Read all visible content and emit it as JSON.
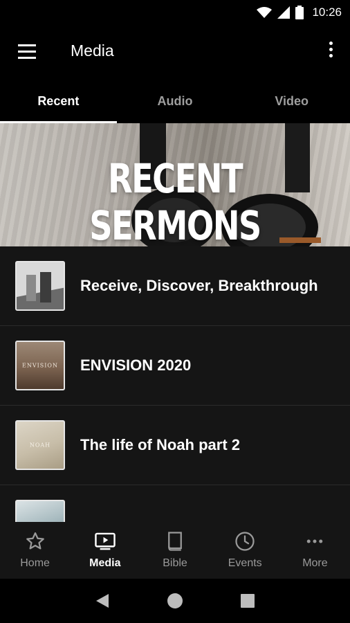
{
  "status_bar": {
    "time": "10:26",
    "icons": [
      "wifi-icon",
      "cell-signal-icon",
      "battery-icon"
    ]
  },
  "app_bar": {
    "title": "Media",
    "menu_icon": "hamburger-icon",
    "overflow_icon": "more-vert-icon"
  },
  "tabs": [
    {
      "label": "Recent",
      "active": true
    },
    {
      "label": "Audio",
      "active": false
    },
    {
      "label": "Video",
      "active": false
    }
  ],
  "banner": {
    "title": "RECENT SERMONS"
  },
  "list": {
    "items": [
      {
        "title": "Receive, Discover, Breakthrough",
        "thumb_text": ""
      },
      {
        "title": "ENVISION 2020",
        "thumb_text": "ENVISION"
      },
      {
        "title": "The life of Noah part 2",
        "thumb_text": "NOAH"
      },
      {
        "title": "",
        "thumb_text": ""
      }
    ]
  },
  "bottom_nav": [
    {
      "label": "Home",
      "icon": "star-icon",
      "active": false
    },
    {
      "label": "Media",
      "icon": "tv-play-icon",
      "active": true
    },
    {
      "label": "Bible",
      "icon": "book-icon",
      "active": false
    },
    {
      "label": "Events",
      "icon": "clock-icon",
      "active": false
    },
    {
      "label": "More",
      "icon": "more-horiz-icon",
      "active": false
    }
  ],
  "system_nav": [
    "back-icon",
    "home-icon",
    "recents-icon"
  ],
  "colors": {
    "background": "#151515",
    "bar": "#000000",
    "inactive": "#9e9e9e",
    "active": "#ffffff"
  }
}
